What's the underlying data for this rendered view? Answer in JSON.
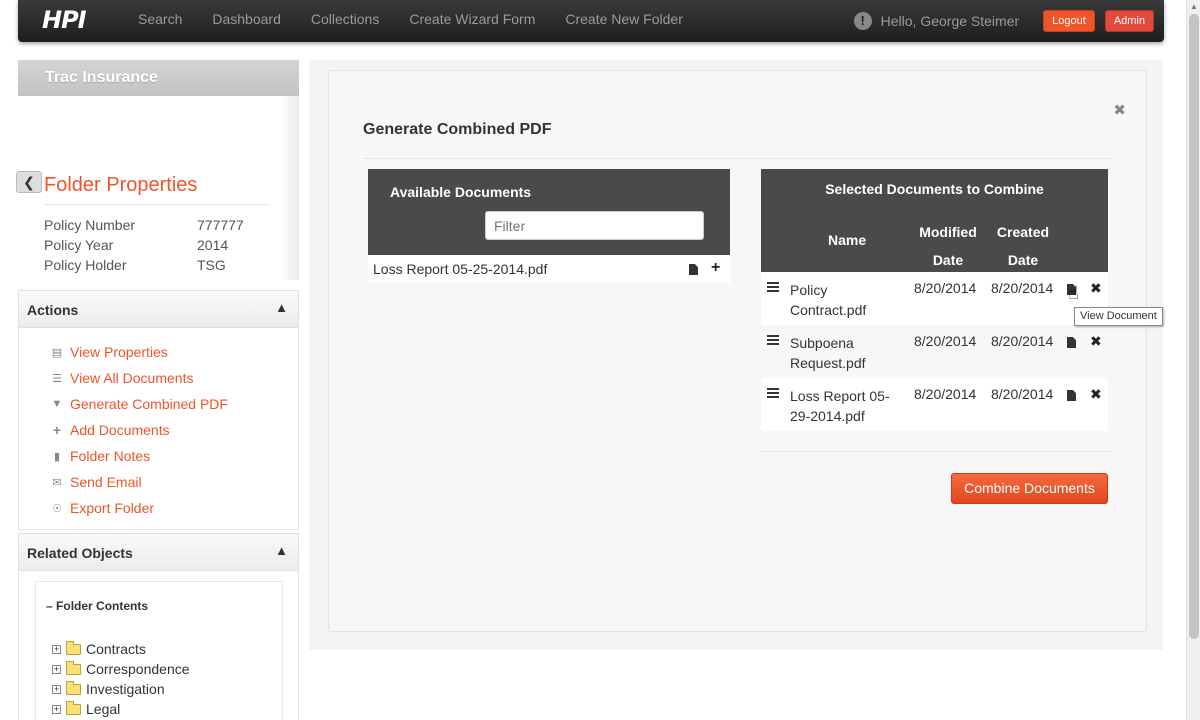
{
  "navbar": {
    "brand": "HPI",
    "links": [
      "Search",
      "Dashboard",
      "Collections",
      "Create Wizard Form",
      "Create New Folder"
    ],
    "greeting": "Hello, George Steimer",
    "logout_label": "Logout",
    "admin_label": "Admin",
    "alert_glyph": "!"
  },
  "sidebar": {
    "header": "Trac Insurance",
    "properties_title": "Folder Properties",
    "properties": [
      {
        "key": "Policy Number",
        "value": "777777"
      },
      {
        "key": "Policy Year",
        "value": "2014"
      },
      {
        "key": "Policy Holder",
        "value": "TSG"
      }
    ],
    "actions_title": "Actions",
    "actions": [
      {
        "label": "View Properties",
        "icon": "list-icon"
      },
      {
        "label": "View All Documents",
        "icon": "list-icon"
      },
      {
        "label": "Generate Combined PDF",
        "icon": "filter-icon"
      },
      {
        "label": "Add Documents",
        "icon": "plus-icon"
      },
      {
        "label": "Folder Notes",
        "icon": "comment-icon"
      },
      {
        "label": "Send Email",
        "icon": "envelope-icon"
      },
      {
        "label": "Export Folder",
        "icon": "export-icon"
      }
    ],
    "related_title": "Related Objects",
    "tree_title": "Folder Contents",
    "tree_items": [
      "Contracts",
      "Correspondence",
      "Investigation",
      "Legal"
    ]
  },
  "modal": {
    "title": "Generate Combined PDF",
    "available": {
      "title": "Available Documents",
      "filter_placeholder": "Filter",
      "docs": [
        "Loss Report 05-25-2014.pdf"
      ]
    },
    "selected": {
      "title": "Selected Documents to Combine",
      "col_name": "Name",
      "col_modified_1": "Modified",
      "col_modified_2": "Date",
      "col_created_1": "Created",
      "col_created_2": "Date",
      "rows": [
        {
          "name_1": "Policy",
          "name_2": "Contract.pdf",
          "modified": "8/20/2014",
          "created": "8/20/2014"
        },
        {
          "name_1": "Subpoena",
          "name_2": "Request.pdf",
          "modified": "8/20/2014",
          "created": "8/20/2014"
        },
        {
          "name_1": "Loss Report 05-",
          "name_2": "29-2014.pdf",
          "modified": "8/20/2014",
          "created": "8/20/2014"
        }
      ]
    },
    "tooltip": "View Document",
    "combine_label": "Combine Documents"
  },
  "colors": {
    "accent": "#f0542a",
    "header_dark": "#4a4a4a"
  }
}
